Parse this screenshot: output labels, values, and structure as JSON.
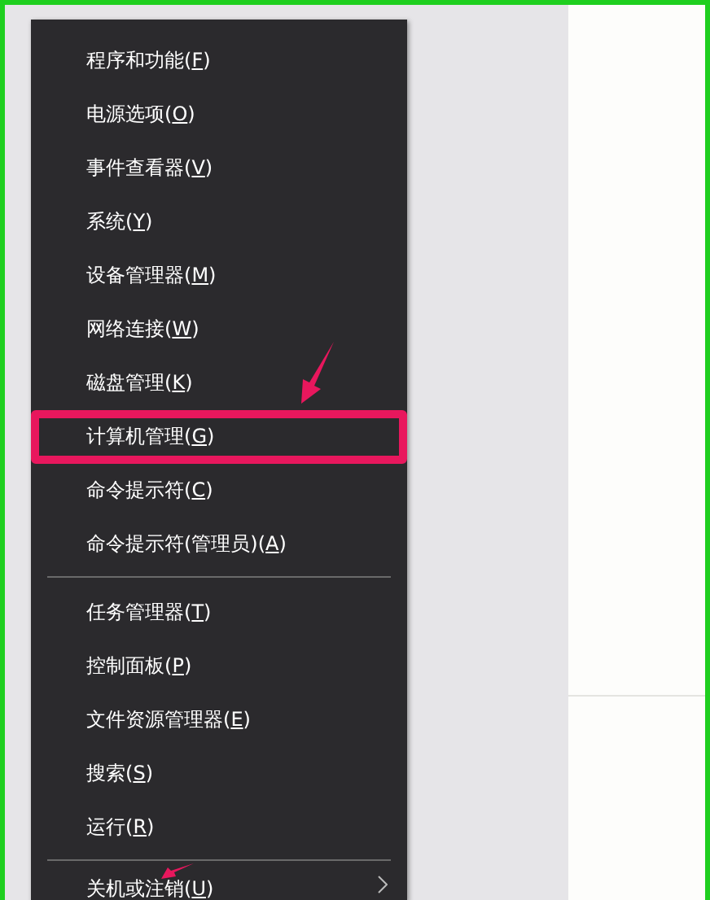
{
  "menu": {
    "groups": [
      [
        {
          "before": "程序和功能(",
          "key": "F",
          "after": ")",
          "highlighted": false,
          "submenu": false
        },
        {
          "before": "电源选项(",
          "key": "O",
          "after": ")",
          "highlighted": false,
          "submenu": false
        },
        {
          "before": "事件查看器(",
          "key": "V",
          "after": ")",
          "highlighted": false,
          "submenu": false
        },
        {
          "before": "系统(",
          "key": "Y",
          "after": ")",
          "highlighted": false,
          "submenu": false
        },
        {
          "before": "设备管理器(",
          "key": "M",
          "after": ")",
          "highlighted": false,
          "submenu": false
        },
        {
          "before": "网络连接(",
          "key": "W",
          "after": ")",
          "highlighted": false,
          "submenu": false
        },
        {
          "before": "磁盘管理(",
          "key": "K",
          "after": ")",
          "highlighted": false,
          "submenu": false
        },
        {
          "before": "计算机管理(",
          "key": "G",
          "after": ")",
          "highlighted": true,
          "submenu": false
        },
        {
          "before": "命令提示符(",
          "key": "C",
          "after": ")",
          "highlighted": false,
          "submenu": false
        },
        {
          "before": "命令提示符(管理员)(",
          "key": "A",
          "after": ")",
          "highlighted": false,
          "submenu": false
        }
      ],
      [
        {
          "before": "任务管理器(",
          "key": "T",
          "after": ")",
          "highlighted": false,
          "submenu": false
        },
        {
          "before": "控制面板(",
          "key": "P",
          "after": ")",
          "highlighted": false,
          "submenu": false
        },
        {
          "before": "文件资源管理器(",
          "key": "E",
          "after": ")",
          "highlighted": false,
          "submenu": false
        },
        {
          "before": "搜索(",
          "key": "S",
          "after": ")",
          "highlighted": false,
          "submenu": false
        },
        {
          "before": "运行(",
          "key": "R",
          "after": ")",
          "highlighted": false,
          "submenu": false
        }
      ],
      [
        {
          "before": "关机或注销(",
          "key": "U",
          "after": ")",
          "highlighted": false,
          "submenu": true
        }
      ]
    ]
  }
}
